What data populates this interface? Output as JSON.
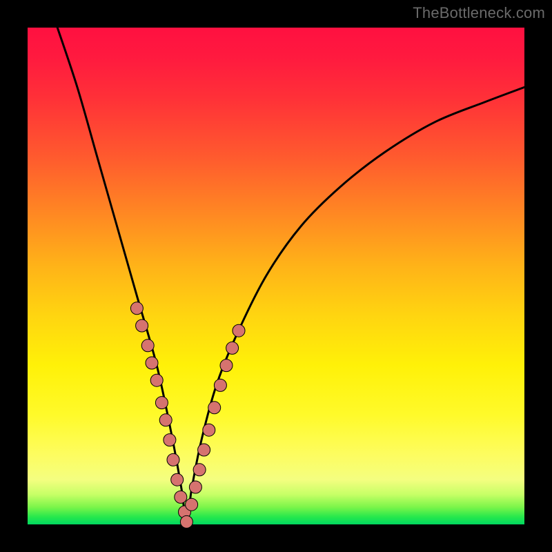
{
  "watermark": "TheBottleneck.com",
  "colors": {
    "curve": "#000000",
    "dot_fill": "#d6736f",
    "dot_stroke": "#000000"
  },
  "chart_data": {
    "type": "line",
    "title": "",
    "xlabel": "",
    "ylabel": "",
    "xlim": [
      0,
      100
    ],
    "ylim": [
      0,
      100
    ],
    "notes": "V-shaped bottleneck curve on a vertical red→green thermal gradient. Curve passes through the green band near x≈32. Axes carry no tick labels; values below are geometric estimates on a 0–100 × 0–100 canvas.",
    "series": [
      {
        "name": "curve",
        "type": "line",
        "x": [
          6,
          10,
          14,
          18,
          22,
          26,
          29,
          31,
          32,
          33,
          35,
          38,
          42,
          48,
          55,
          63,
          72,
          82,
          92,
          100
        ],
        "y": [
          100,
          88,
          74,
          60,
          46,
          32,
          18,
          7,
          0,
          7,
          17,
          28,
          38,
          50,
          60,
          68,
          75,
          81,
          85,
          88
        ]
      },
      {
        "name": "left-dots",
        "type": "scatter",
        "x": [
          22.0,
          23.0,
          24.2,
          25.0,
          26.0,
          27.0,
          27.8,
          28.6,
          29.3,
          30.1,
          30.8,
          31.6,
          32.0
        ],
        "y": [
          43.5,
          40.0,
          36.0,
          32.5,
          29.0,
          24.5,
          21.0,
          17.0,
          13.0,
          9.0,
          5.5,
          2.5,
          0.5
        ]
      },
      {
        "name": "right-dots",
        "type": "scatter",
        "x": [
          33.0,
          33.8,
          34.6,
          35.5,
          36.5,
          37.6,
          38.8,
          40.0,
          41.2,
          42.5
        ],
        "y": [
          4.0,
          7.5,
          11.0,
          15.0,
          19.0,
          23.5,
          28.0,
          32.0,
          35.5,
          39.0
        ]
      }
    ]
  }
}
